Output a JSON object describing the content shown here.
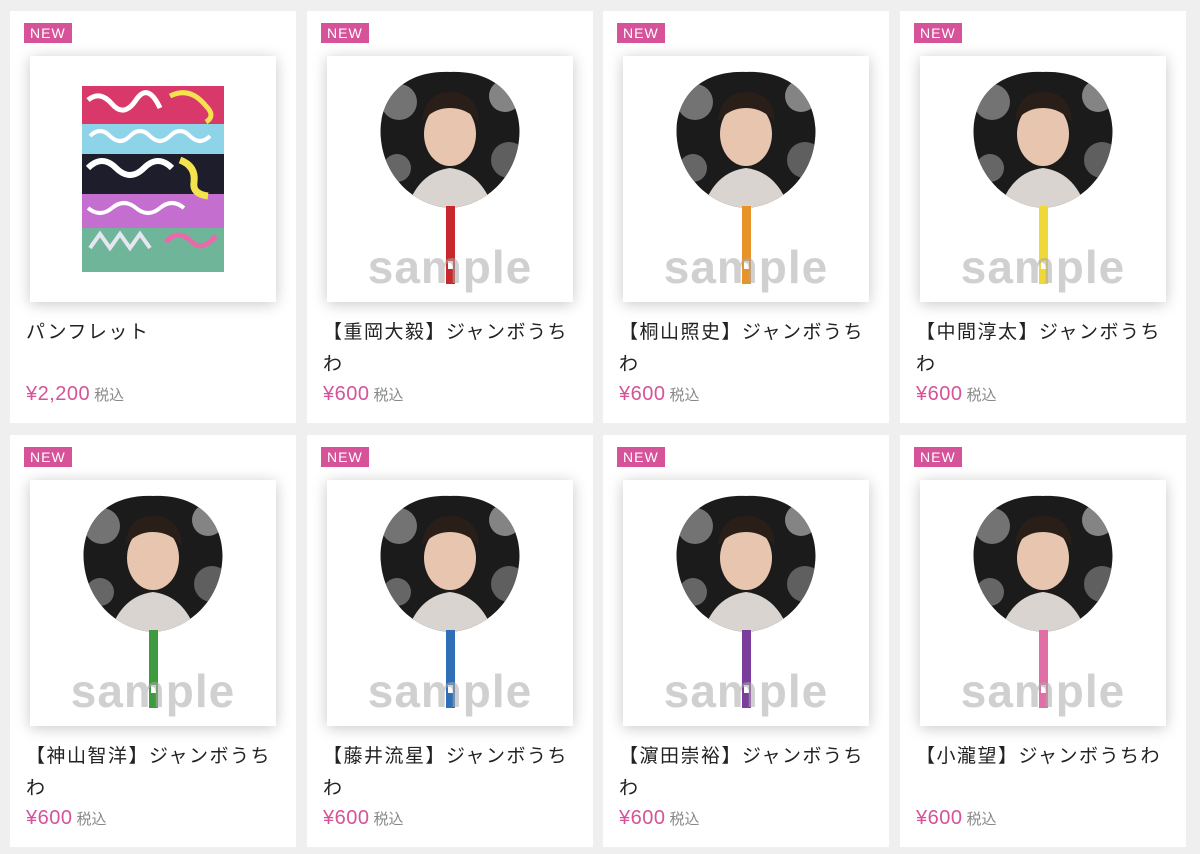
{
  "products": [
    {
      "badge": "NEW",
      "title": "パンフレット",
      "price": "¥2,200",
      "tax": "税込",
      "image": "pamphlet",
      "handle_color": ""
    },
    {
      "badge": "NEW",
      "title": "【重岡大毅】ジャンボうちわ",
      "price": "¥600",
      "tax": "税込",
      "image": "jumbo-uchiwa",
      "watermark": "sample",
      "handle_color": "#c8282b"
    },
    {
      "badge": "NEW",
      "title": "【桐山照史】ジャンボうちわ",
      "price": "¥600",
      "tax": "税込",
      "image": "jumbo-uchiwa",
      "watermark": "sample",
      "handle_color": "#e8922a"
    },
    {
      "badge": "NEW",
      "title": "【中間淳太】ジャンボうちわ",
      "price": "¥600",
      "tax": "税込",
      "image": "jumbo-uchiwa",
      "watermark": "sample",
      "handle_color": "#f0d83a"
    },
    {
      "badge": "NEW",
      "title": "【神山智洋】ジャンボうちわ",
      "price": "¥600",
      "tax": "税込",
      "image": "jumbo-uchiwa",
      "watermark": "sample",
      "handle_color": "#3e9a3e"
    },
    {
      "badge": "NEW",
      "title": "【藤井流星】ジャンボうちわ",
      "price": "¥600",
      "tax": "税込",
      "image": "jumbo-uchiwa",
      "watermark": "sample",
      "handle_color": "#2f6fb7"
    },
    {
      "badge": "NEW",
      "title": "【濵田崇裕】ジャンボうちわ",
      "price": "¥600",
      "tax": "税込",
      "image": "jumbo-uchiwa",
      "watermark": "sample",
      "handle_color": "#7a3d9c"
    },
    {
      "badge": "NEW",
      "title": "【小瀧望】ジャンボうちわ",
      "price": "¥600",
      "tax": "税込",
      "image": "jumbo-uchiwa",
      "watermark": "sample",
      "handle_color": "#df6fa5"
    }
  ],
  "colors": {
    "accent": "#d6539a",
    "background": "#efefef",
    "card": "#ffffff"
  }
}
